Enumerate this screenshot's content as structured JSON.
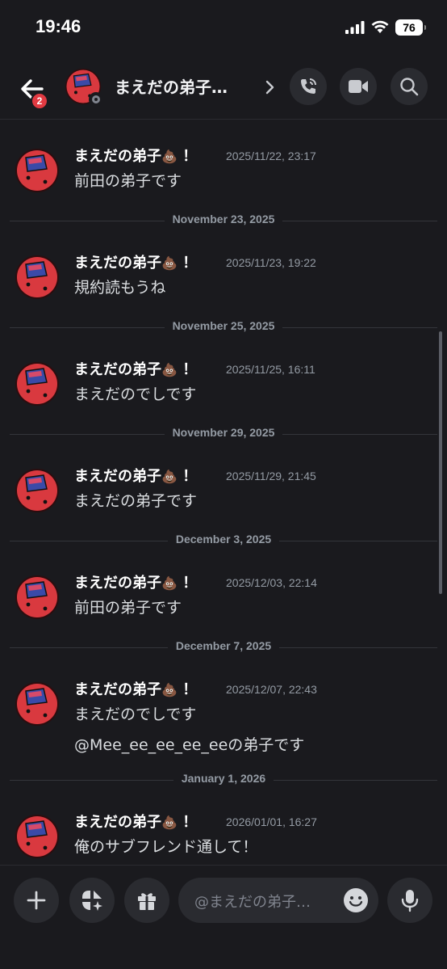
{
  "status_bar": {
    "time": "19:46",
    "battery": "76"
  },
  "header": {
    "title": "まえだの弟子…",
    "badge_count": "2"
  },
  "dividers": [
    "November 23, 2025",
    "November 25, 2025",
    "November 29, 2025",
    "December 3, 2025",
    "December 7, 2025",
    "January 1, 2026"
  ],
  "messages": [
    {
      "author": "まえだの弟子",
      "emoji": "💩",
      "suffix": "！",
      "time": "2025/11/22, 23:17",
      "text": "前田の弟子です"
    },
    {
      "author": "まえだの弟子",
      "emoji": "💩",
      "suffix": "！",
      "time": "2025/11/23, 19:22",
      "text": "規約読もうね"
    },
    {
      "author": "まえだの弟子",
      "emoji": "💩",
      "suffix": "！",
      "time": "2025/11/25, 16:11",
      "text": "まえだのでしです"
    },
    {
      "author": "まえだの弟子",
      "emoji": "💩",
      "suffix": "！",
      "time": "2025/11/29, 21:45",
      "text": "まえだの弟子です"
    },
    {
      "author": "まえだの弟子",
      "emoji": "💩",
      "suffix": "！",
      "time": "2025/12/03, 22:14",
      "text": "前田の弟子です"
    },
    {
      "author": "まえだの弟子",
      "emoji": "💩",
      "suffix": "！",
      "time": "2025/12/07, 22:43",
      "text": "まえだのでしです",
      "text2": "@Mee_ee_ee_ee_eeの弟子です"
    },
    {
      "author": "まえだの弟子",
      "emoji": "💩",
      "suffix": "！",
      "time": "2026/01/01, 16:27",
      "text": "俺のサブフレンド通して！"
    }
  ],
  "composer": {
    "placeholder": "@まえだの弟子…"
  },
  "colors": {
    "background": "#1a1a1e",
    "badge": "#e23a42",
    "avatar_red": "#d9393f",
    "avatar_blue": "#3a4aa8"
  }
}
